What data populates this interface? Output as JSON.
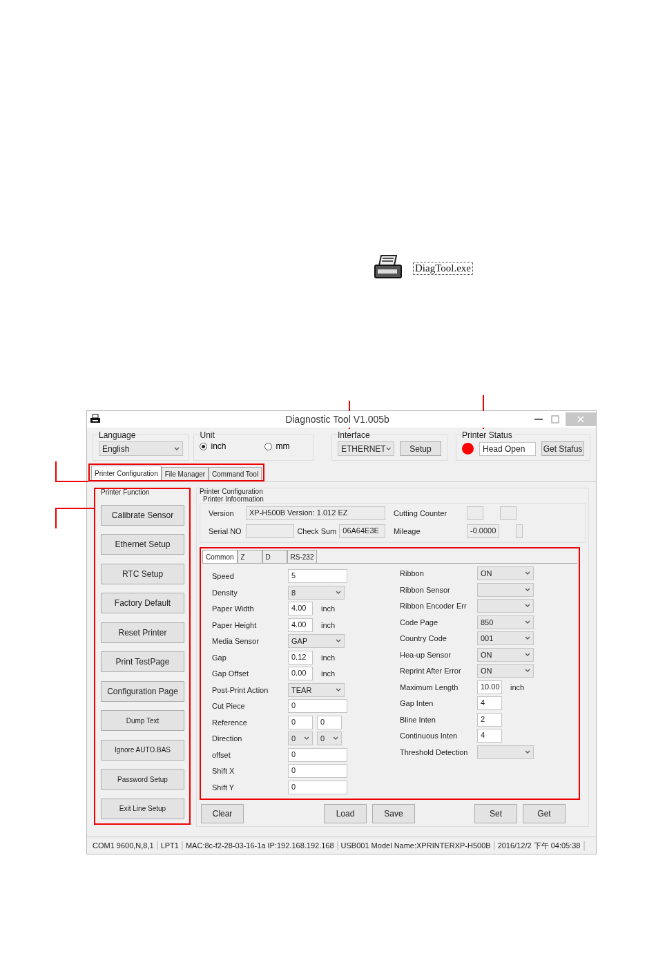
{
  "file_icon": {
    "label": "DiagTool.exe"
  },
  "window": {
    "title": "Diagnostic Tool V1.005b"
  },
  "language": {
    "label": "Language",
    "value": "English"
  },
  "unit": {
    "label": "Unit",
    "options": [
      {
        "label": "inch",
        "selected": true
      },
      {
        "label": "mm",
        "selected": false
      }
    ]
  },
  "interface": {
    "label": "Interface",
    "value": "ETHERNET",
    "button": "Setup"
  },
  "printer_status": {
    "label": "Printer  Status",
    "value": "Head Open",
    "button": "Get Stafus"
  },
  "tabs": [
    {
      "label": "Printer Configuration",
      "selected": true
    },
    {
      "label": "File Manager",
      "selected": false
    },
    {
      "label": "Command Tool",
      "selected": false
    }
  ],
  "printer_function": {
    "title": "Printer  Function",
    "buttons": [
      "Calibrate Sensor",
      "Ethernet Setup",
      "RTC Setup",
      "Factory Default",
      "Reset Printer",
      "Print TestPage",
      "Configuration Page",
      "Dump Text",
      "Ignore AUTO.BAS",
      "Password Setup",
      "Exit Line Setup"
    ]
  },
  "printer_configuration": {
    "title": "Printer Configuration",
    "info_title": "Printer Infoormation",
    "version": {
      "label": "Version",
      "value": "XP-H500B Version: 1.012 EZ"
    },
    "cutting_counter": {
      "label": "Cutting Counter"
    },
    "serial_no": {
      "label": "Serial NO"
    },
    "check_sum": {
      "label": "Check Sum",
      "value": "06A64E3E"
    },
    "mileage": {
      "label": "Mileage",
      "value": "-0.0000"
    }
  },
  "sub_tabs": [
    {
      "label": "Common",
      "selected": true
    },
    {
      "label": "Z",
      "selected": false
    },
    {
      "label": "D",
      "selected": false
    },
    {
      "label": "RS-232",
      "selected": false
    }
  ],
  "left_fields": [
    {
      "kind": "text",
      "label": "Speed",
      "value": "5"
    },
    {
      "kind": "select",
      "label": "Density",
      "value": "8"
    },
    {
      "kind": "text_unit",
      "label": "Paper Width",
      "value": "4.00",
      "unit": "inch"
    },
    {
      "kind": "text_unit",
      "label": "Paper Height",
      "value": "4.00",
      "unit": "inch"
    },
    {
      "kind": "select",
      "label": "Media Sensor",
      "value": "GAP"
    },
    {
      "kind": "text_unit",
      "label": "Gap",
      "value": "0.12",
      "unit": "inch"
    },
    {
      "kind": "text_unit",
      "label": "Gap Offset",
      "value": "0.00",
      "unit": "inch"
    },
    {
      "kind": "select",
      "label": "Post-Print Action",
      "value": "TEAR"
    },
    {
      "kind": "text",
      "label": "Cut  Piece",
      "value": "0"
    },
    {
      "kind": "text_pair",
      "label": "Reference",
      "values": [
        "0",
        "0"
      ]
    },
    {
      "kind": "select_pair",
      "label": "Direction",
      "values": [
        "0",
        "0"
      ]
    },
    {
      "kind": "text",
      "label": "offset",
      "value": "0"
    },
    {
      "kind": "text",
      "label": "Shift X",
      "value": "0"
    },
    {
      "kind": "text",
      "label": "Shift Y",
      "value": "0"
    }
  ],
  "right_fields": [
    {
      "kind": "select",
      "label": "Ribbon",
      "value": "ON"
    },
    {
      "kind": "select",
      "label": "Ribbon  Sensor"
    },
    {
      "kind": "select",
      "label": "Ribbon Encoder Err"
    },
    {
      "kind": "select",
      "label": "Code Page",
      "value": "850"
    },
    {
      "kind": "select",
      "label": "Country Code",
      "value": "001"
    },
    {
      "kind": "select",
      "label": "Hea-up  Sensor",
      "value": "ON"
    },
    {
      "kind": "select",
      "label": "Reprint After  Error",
      "value": "ON"
    },
    {
      "kind": "text_unit",
      "label": "Maximum Length",
      "value": "10.00",
      "unit": "inch"
    },
    {
      "kind": "text",
      "label": "Gap Inten",
      "value": "4"
    },
    {
      "kind": "text",
      "label": "Bline  Inten",
      "value": "2"
    },
    {
      "kind": "text",
      "label": "Continuous  Inten",
      "value": "4"
    },
    {
      "kind": "select",
      "label": "Threshold  Detection"
    }
  ],
  "bottom_buttons": [
    "Clear",
    "Load",
    "Save",
    "Set",
    "Get"
  ],
  "status_bar": [
    "COM1 9600,N,8,1",
    "LPT1",
    "MAC:8c-f2-28-03-16-1a  IP:192.168.192.168",
    "USB001  Model Name:XPRINTERXP-H500B",
    "2016/12/2 下午 04:05:38"
  ]
}
